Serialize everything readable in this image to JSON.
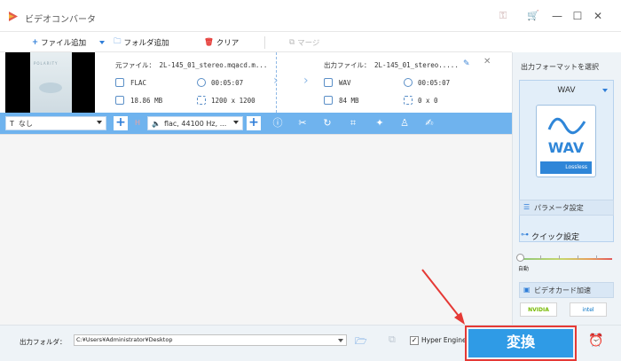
{
  "window": {
    "title": "ビデオコンバータ",
    "title_icons": [
      "key-icon",
      "cart-icon"
    ],
    "controls": {
      "minimize": "—",
      "maximize": "☐",
      "close": "✕"
    }
  },
  "toolbar": {
    "add_file_label": "ファイル追加",
    "add_folder_label": "フォルダ追加",
    "clear_label": "クリア",
    "merge_label": "マージ"
  },
  "file_item": {
    "source": {
      "filename": "元ファイル： 2L-145_01_stereo.mqacd.m...",
      "format": "FLAC",
      "duration": "00:05:07",
      "size": "18.86 MB",
      "resolution": "1200 x 1200"
    },
    "output": {
      "filename": "出力ファイル： 2L-145_01_stereo.....",
      "format": "WAV",
      "duration": "00:05:07",
      "size": "84 MB",
      "resolution": "0 x 0"
    },
    "thumbnail_text": "POLARITY"
  },
  "edit_bar": {
    "subtitle_value": "なし",
    "audio_value": "flac, 44100 Hz, ...",
    "tool_icons": [
      "info-icon",
      "scissors-icon",
      "rotate-icon",
      "crop-icon",
      "effects-icon",
      "watermark-icon",
      "subtitle-edit-icon"
    ]
  },
  "sidebar": {
    "title": "出力フォーマットを選択",
    "format_name": "WAV",
    "card_text": "WAV",
    "card_badge": "Lossless",
    "params_label": "パラメータ設定",
    "quick_label": "クイック設定",
    "auto_label": "自動",
    "gpu_label": "ビデオカード加速",
    "nvidia_label": "NVIDIA",
    "intel_label": "intel"
  },
  "bottom": {
    "output_folder_label": "出力フォルダ：",
    "output_path": "C:¥Users¥Administrator¥Desktop",
    "hyper_engine_label": "Hyper Engine",
    "hyper_engine_checked": "✓",
    "convert_label": "変換"
  },
  "colors": {
    "accent": "#2f9be6",
    "bar_blue": "#6fb3ee",
    "highlight_red": "#e53935"
  }
}
